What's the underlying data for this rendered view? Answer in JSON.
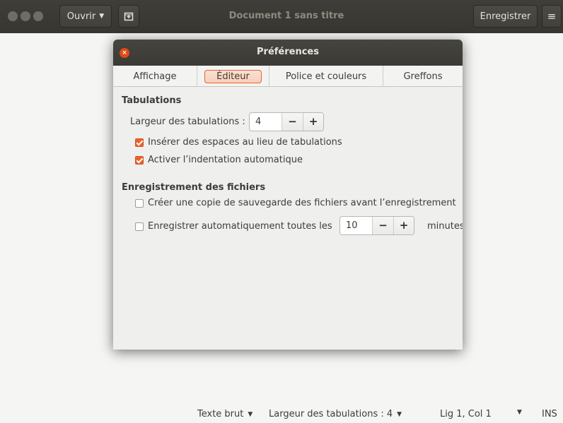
{
  "headerbar": {
    "open_label": "Ouvrir",
    "new_icon": "new-tab-icon",
    "title": "Document 1 sans titre",
    "save_label": "Enregistrer",
    "menu_glyph": "≡"
  },
  "dialog": {
    "title": "Préférences",
    "close_glyph": "×",
    "tabs": [
      {
        "label": "Affichage",
        "active": false
      },
      {
        "label": "Éditeur",
        "active": true
      },
      {
        "label": "Police et couleurs",
        "active": false
      },
      {
        "label": "Greffons",
        "active": false
      }
    ],
    "tabulations": {
      "title": "Tabulations",
      "width_label": "Largeur des tabulations :",
      "width_value": "4",
      "minus": "−",
      "plus": "+",
      "insert_spaces": {
        "label": "Insérer des espaces au lieu de tabulations",
        "checked": true
      },
      "auto_indent": {
        "label": "Activer l’indentation automatique",
        "checked": true
      }
    },
    "saving": {
      "title": "Enregistrement des fichiers",
      "backup": {
        "label": "Créer une copie de sauvegarde des fichiers avant l’enregistrement",
        "checked": false
      },
      "autosave": {
        "label": "Enregistrer automatiquement toutes les",
        "checked": false
      },
      "autosave_value": "10",
      "minus": "−",
      "plus": "+",
      "minutes_label": "minutes"
    }
  },
  "statusbar": {
    "language": "Texte brut",
    "tab_width": "Largeur des tabulations : 4",
    "position": "Lig 1, Col 1",
    "mode": "INS"
  },
  "colors": {
    "accent": "#e9632c",
    "header": "#3c3b37",
    "close": "#df4a16"
  }
}
